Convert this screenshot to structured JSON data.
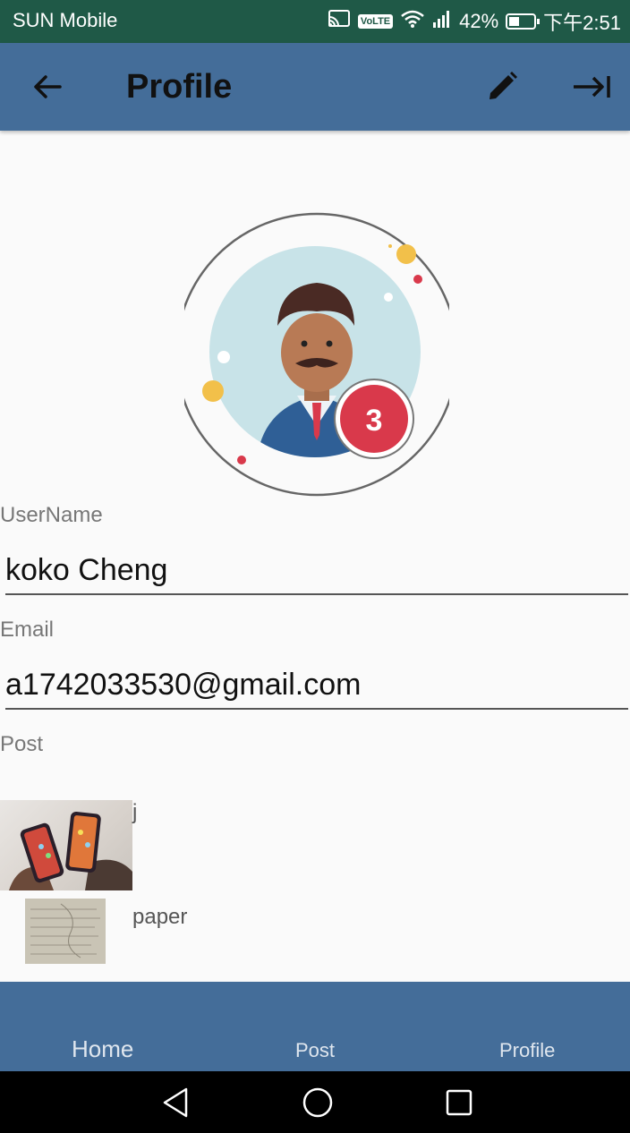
{
  "status_bar": {
    "carrier": "SUN Mobile",
    "volte": "VoLTE",
    "battery_percent": "42%",
    "battery_level": 0.42,
    "time": "下午2:51",
    "icons": [
      "cast-icon",
      "volte-icon",
      "wifi-icon",
      "signal-icon",
      "battery-icon"
    ]
  },
  "app_bar": {
    "title": "Profile",
    "icons": [
      "arrow-back-icon",
      "pencil-edit-icon",
      "logout-arrow-icon"
    ],
    "color": "#446d99"
  },
  "avatar": {
    "notification_count": "3",
    "badge_color": "#d9394b"
  },
  "fields": {
    "username": {
      "label": "UserName",
      "value": "koko Cheng"
    },
    "email": {
      "label": "Email",
      "value": "a1742033530@gmail.com"
    },
    "post_label": "Post"
  },
  "posts": [
    {
      "title": "j",
      "thumbnail": "two-phones-photo"
    },
    {
      "title": "paper",
      "thumbnail": "paper-photo"
    }
  ],
  "bottom_nav": {
    "items": [
      {
        "label": "Home",
        "active": true
      },
      {
        "label": "Post",
        "active": false
      },
      {
        "label": "Profile",
        "active": false
      }
    ]
  },
  "system_nav": {
    "icons": [
      "back-triangle-icon",
      "home-circle-icon",
      "recents-square-icon"
    ]
  }
}
